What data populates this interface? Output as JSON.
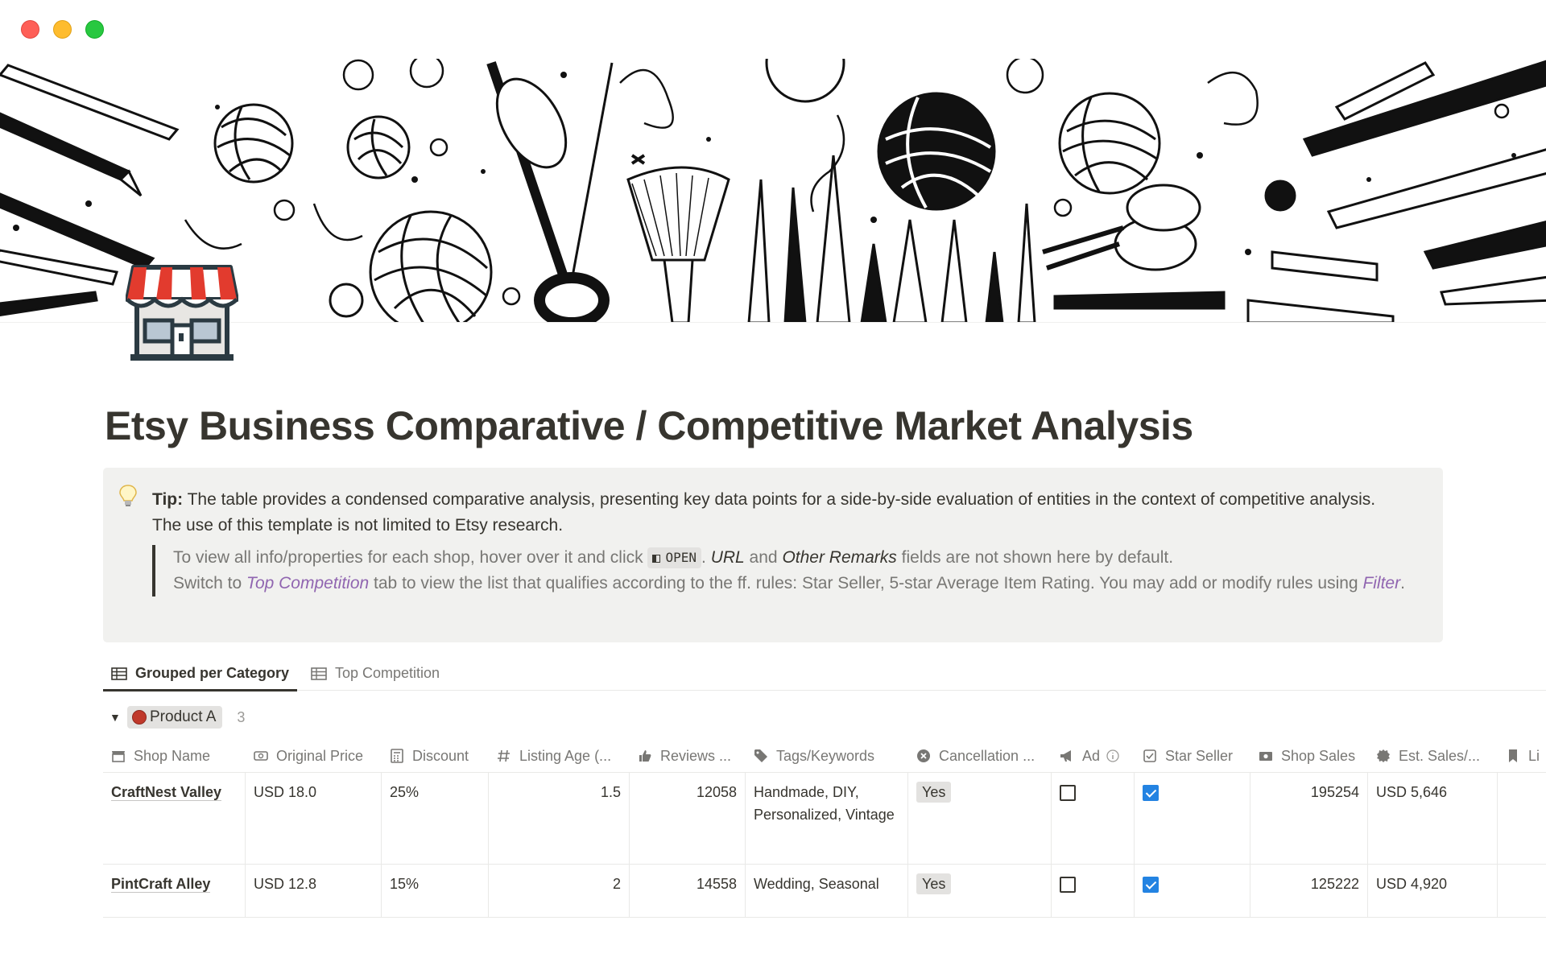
{
  "window": {
    "controls": [
      "close",
      "minimize",
      "zoom"
    ]
  },
  "page": {
    "icon": "storefront-icon",
    "title": "Etsy Business Comparative / Competitive Market Analysis"
  },
  "callout": {
    "icon": "lightbulb-icon",
    "tip_label": "Tip:",
    "tip_text": "The table provides a condensed comparative analysis, presenting key data points for a side-by-side evaluation of entities in the context of competitive analysis. The use of this template is not limited to Etsy research.",
    "quote": {
      "line1_a": "To view all info/properties for each shop, hover over it and click",
      "open_chip": "OPEN",
      "line1_b": ".",
      "url_field": "URL",
      "and": "and",
      "remarks_field": "Other Remarks",
      "line1_c": "fields are not shown here by default.",
      "line2_a": "Switch to",
      "top_comp_link": "Top Competition",
      "line2_b": "tab to view the list that qualifies according to the ff. rules: Star Seller, 5-star Average Item Rating. You may add or modify rules using",
      "filter_link": "Filter",
      "line2_c": "."
    }
  },
  "tabs": [
    {
      "label": "Grouped per Category",
      "icon": "table-icon",
      "active": true
    },
    {
      "label": "Top Competition",
      "icon": "table-icon",
      "active": false
    }
  ],
  "group": {
    "label": "Product A",
    "icon": "yarn-ball-icon",
    "count": "3"
  },
  "columns": [
    {
      "label": "Shop Name",
      "icon": "shop-icon"
    },
    {
      "label": "Original Price",
      "icon": "price-tag-icon"
    },
    {
      "label": "Discount",
      "icon": "calculator-icon"
    },
    {
      "label": "Listing Age (...",
      "icon": "hash-icon"
    },
    {
      "label": "Reviews ...",
      "icon": "thumbs-up-icon"
    },
    {
      "label": "Tags/Keywords",
      "icon": "tag-icon"
    },
    {
      "label": "Cancellation ...",
      "icon": "x-circle-icon"
    },
    {
      "label": "Ad",
      "icon": "megaphone-icon"
    },
    {
      "label": "Star Seller",
      "icon": "checkbox-icon"
    },
    {
      "label": "Shop Sales",
      "icon": "money-icon"
    },
    {
      "label": "Est. Sales/...",
      "icon": "badge-icon"
    },
    {
      "label": "Li",
      "icon": "bookmark-icon"
    }
  ],
  "rows": [
    {
      "shop_name": "CraftNest Valley",
      "original_price": "USD 18.0",
      "discount": "25%",
      "listing_age": "1.5",
      "reviews": "12058",
      "tags": "Handmade, DIY, Personalized, Vintage",
      "cancellation": "Yes",
      "ad": false,
      "star_seller": true,
      "shop_sales": "195254",
      "est_sales": "USD 5,646"
    },
    {
      "shop_name": "PintCraft Alley",
      "original_price": "USD 12.8",
      "discount": "15%",
      "listing_age": "2",
      "reviews": "14558",
      "tags": "Wedding, Seasonal",
      "cancellation": "Yes",
      "ad": false,
      "star_seller": true,
      "shop_sales": "125222",
      "est_sales": "USD 4,920"
    }
  ],
  "colors": {
    "text": "#37352f",
    "muted": "#787774",
    "callout_bg": "#f1f1ef",
    "link_purple": "#9065b0",
    "checkbox_blue": "#2383e2"
  }
}
